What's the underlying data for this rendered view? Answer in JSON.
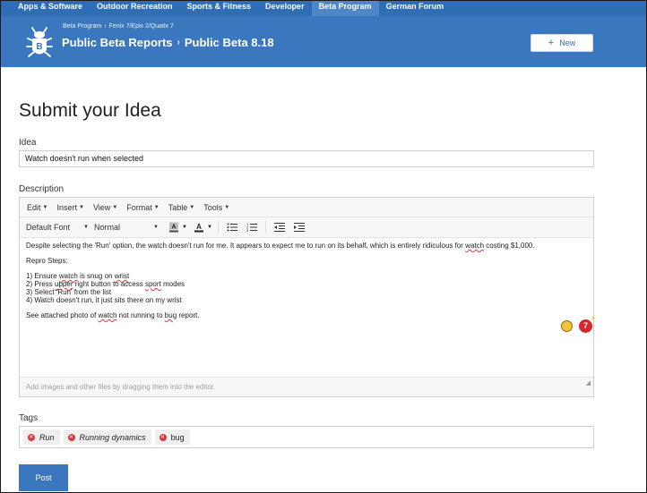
{
  "nav": {
    "items": [
      {
        "label": "Apps & Software"
      },
      {
        "label": "Outdoor Recreation"
      },
      {
        "label": "Sports & Fitness"
      },
      {
        "label": "Developer"
      },
      {
        "label": "Beta Program",
        "active": true
      },
      {
        "label": "German Forum"
      }
    ]
  },
  "header": {
    "breadcrumbs": [
      "Beta Program",
      "Fenix 7/Epix 2/Quatix 7"
    ],
    "title_parent": "Public Beta Reports",
    "title_current": "Public Beta 8.18",
    "new_button": "New"
  },
  "form": {
    "page_title": "Submit your Idea",
    "idea_label": "Idea",
    "idea_value": "Watch doesn't run when selected",
    "description_label": "Description",
    "editor": {
      "menu": [
        "Edit",
        "Insert",
        "View",
        "Format",
        "Table",
        "Tools"
      ],
      "font_family": "Default Font",
      "font_size": "Normal",
      "content": {
        "p1": [
          "Despite selecting the 'Run' option, the watch doesn't run for me. It appears to expect me to run on its behalf, which is entirely ridiculous for ",
          "watch",
          " costing $1,000."
        ],
        "p2": "Repro Steps:",
        "step1": [
          "1) Ensure ",
          "watch",
          " is snug on ",
          "wrist"
        ],
        "step2": [
          "2) Press ",
          "upper",
          " right button to access ",
          "sport",
          " modes"
        ],
        "step3": "3) Select 'Run' from the list",
        "step4": "4) Watch doesn't run, it just sits there on my wrist",
        "p4": [
          "See attached photo of ",
          "watch",
          " not running to ",
          "bug",
          " report."
        ]
      },
      "dropzone": "Add images and other files by dragging them into the editor.",
      "badge_count": "7"
    },
    "tags_label": "Tags",
    "tags": [
      {
        "label": "Run"
      },
      {
        "label": "Running dynamics"
      },
      {
        "label": "bug"
      }
    ],
    "post_button": "Post"
  },
  "colors": {
    "brand_blue": "#3a77be",
    "nav_blue": "#2f6db5",
    "tag_remove_red": "#d9363e"
  }
}
